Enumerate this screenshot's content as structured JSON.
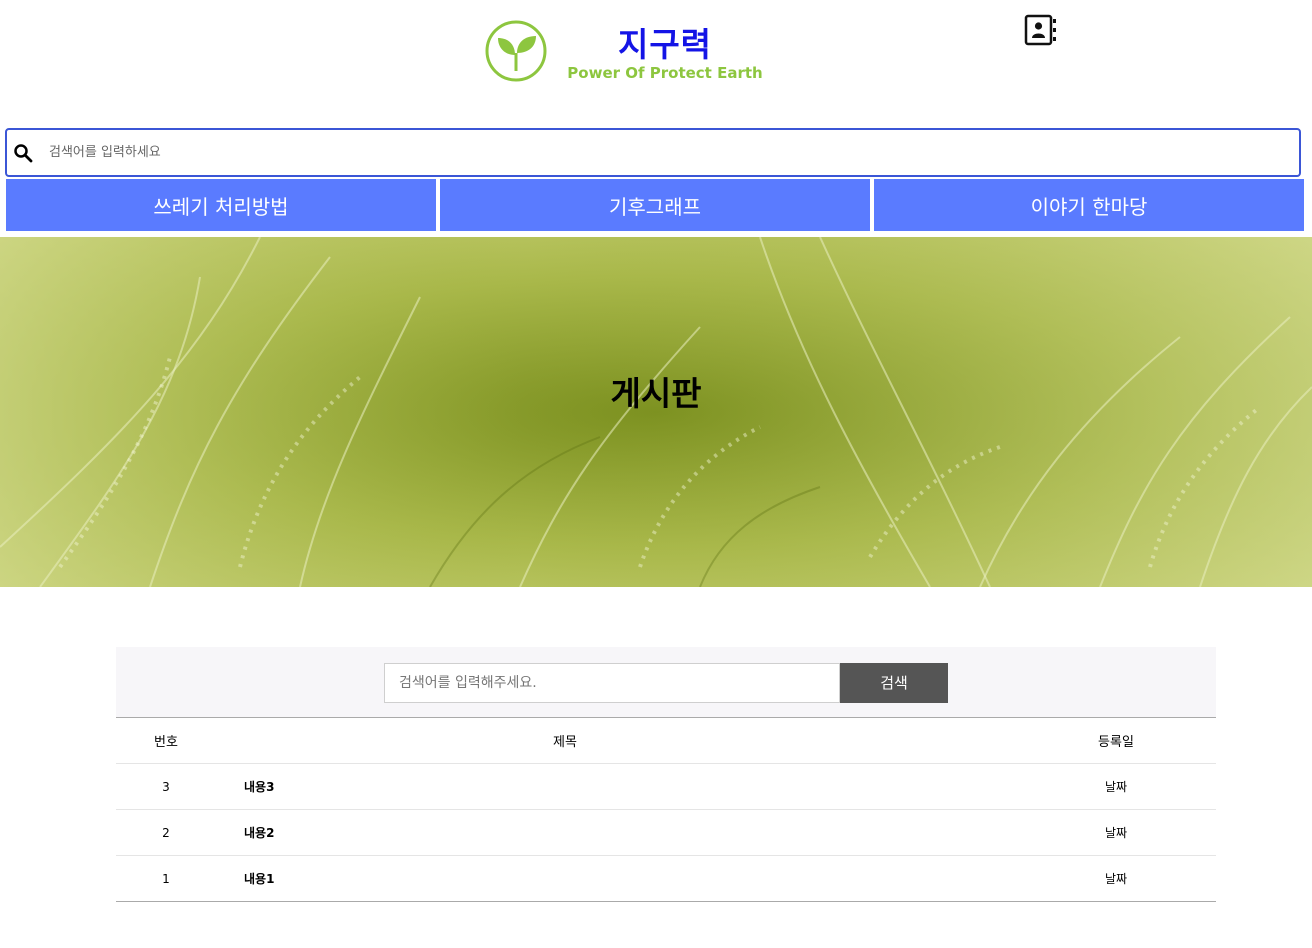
{
  "header": {
    "logo_icon": "sprout-circle-icon",
    "title": "지구력",
    "subtitle": "Power Of Protect Earth",
    "contact_icon": "address-book-icon"
  },
  "top_search": {
    "icon": "search-icon",
    "placeholder": "검색어를 입력하세요"
  },
  "nav": {
    "items": [
      {
        "label": "쓰레기 처리방법"
      },
      {
        "label": "기후그래프"
      },
      {
        "label": "이야기 한마당"
      }
    ]
  },
  "hero": {
    "title": "게시판"
  },
  "board": {
    "search_placeholder": "검색어를 입력해주세요.",
    "search_button": "검색",
    "columns": {
      "num": "번호",
      "title": "제목",
      "date": "등록일"
    },
    "rows": [
      {
        "num": "3",
        "title": "내용3",
        "date": "날짜"
      },
      {
        "num": "2",
        "title": "내용2",
        "date": "날짜"
      },
      {
        "num": "1",
        "title": "내용1",
        "date": "날짜"
      }
    ]
  },
  "colors": {
    "brand_title": "#1414e6",
    "brand_sub": "#8dc63f",
    "nav_bg": "#5a7bff",
    "search_border": "#3b56d6",
    "board_button": "#555555"
  }
}
